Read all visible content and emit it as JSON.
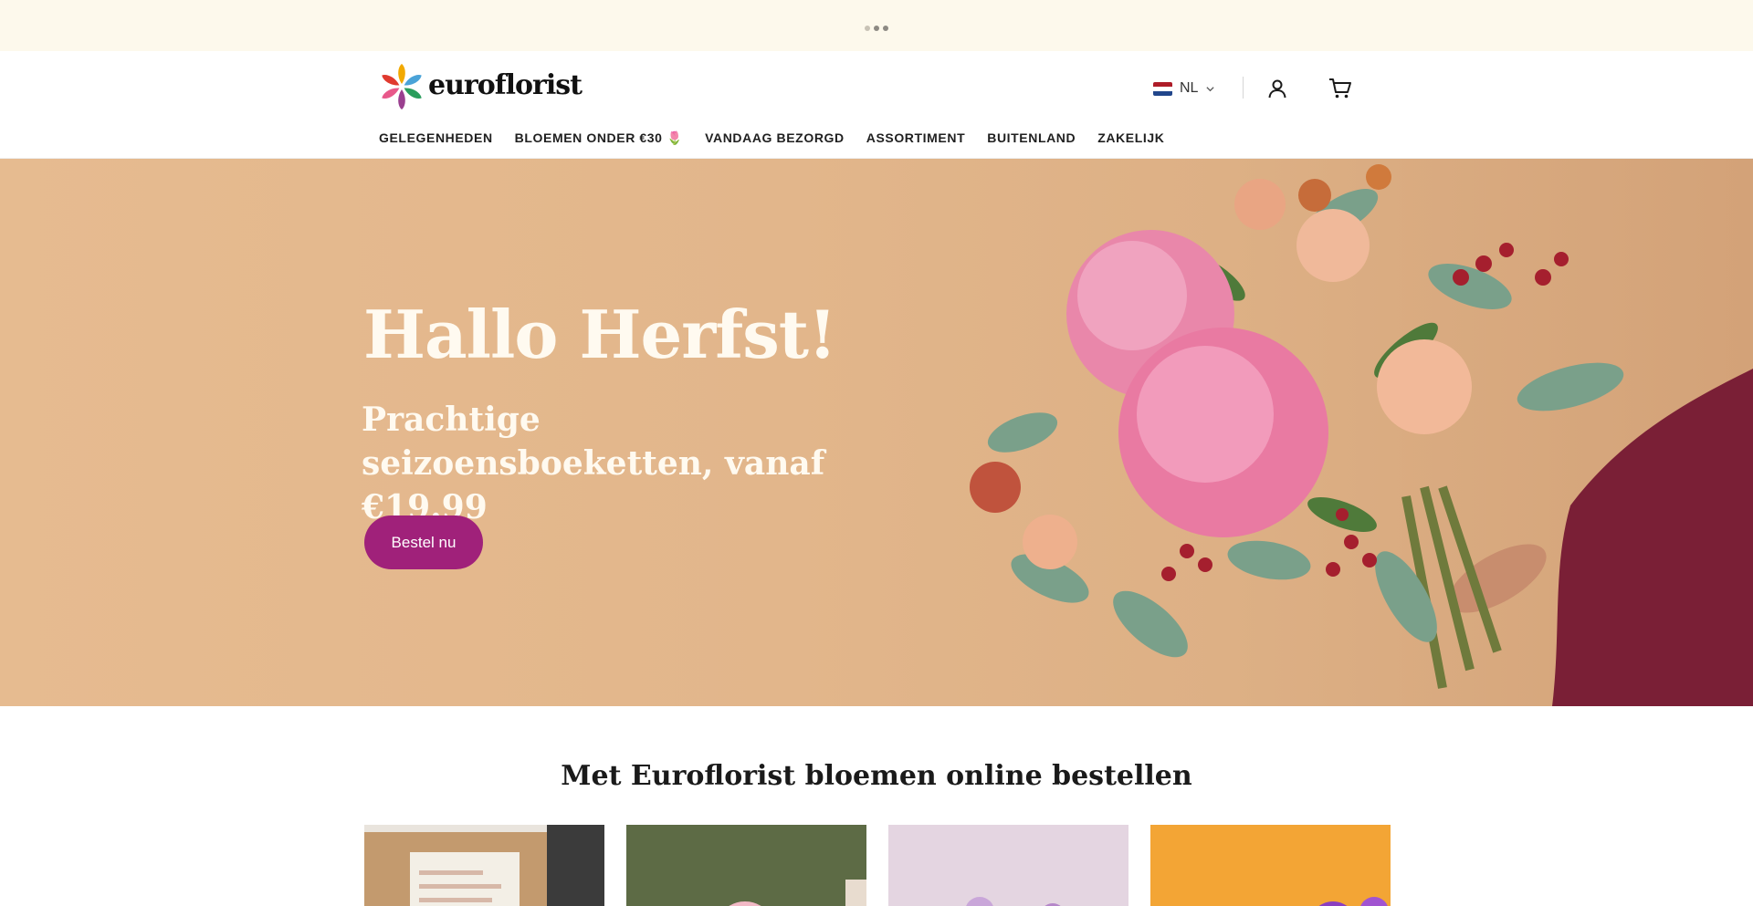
{
  "announcement": {
    "slide_count": 3,
    "active_slide": 2
  },
  "header": {
    "logo_text": "euroflorist",
    "language": {
      "label": "NL",
      "flag_colors": [
        "#ae1c28",
        "#ffffff",
        "#21468b"
      ]
    },
    "account_icon": "user-icon",
    "cart_icon": "cart-icon"
  },
  "nav": {
    "items": [
      {
        "label": "GELEGENHEDEN"
      },
      {
        "label": "BLOEMEN ONDER €30 🌷"
      },
      {
        "label": "VANDAAG BEZORGD"
      },
      {
        "label": "ASSORTIMENT"
      },
      {
        "label": "BUITENLAND"
      },
      {
        "label": "ZAKELIJK"
      }
    ]
  },
  "hero": {
    "title": "Hallo Herfst!",
    "subtitle": "Prachtige seizoensboeketten, vanaf €19.99",
    "cta_label": "Bestel nu"
  },
  "section": {
    "title": "Met Euroflorist bloemen online bestellen",
    "cards": [
      {
        "name": "card-box"
      },
      {
        "name": "card-lilies"
      },
      {
        "name": "card-pastel"
      },
      {
        "name": "card-orange"
      }
    ]
  },
  "colors": {
    "brand_purple": "#a0217a",
    "topbar_bg": "#fdf9ec",
    "hero_bg": "#e2b68b",
    "hero_text": "#fffaf0"
  }
}
